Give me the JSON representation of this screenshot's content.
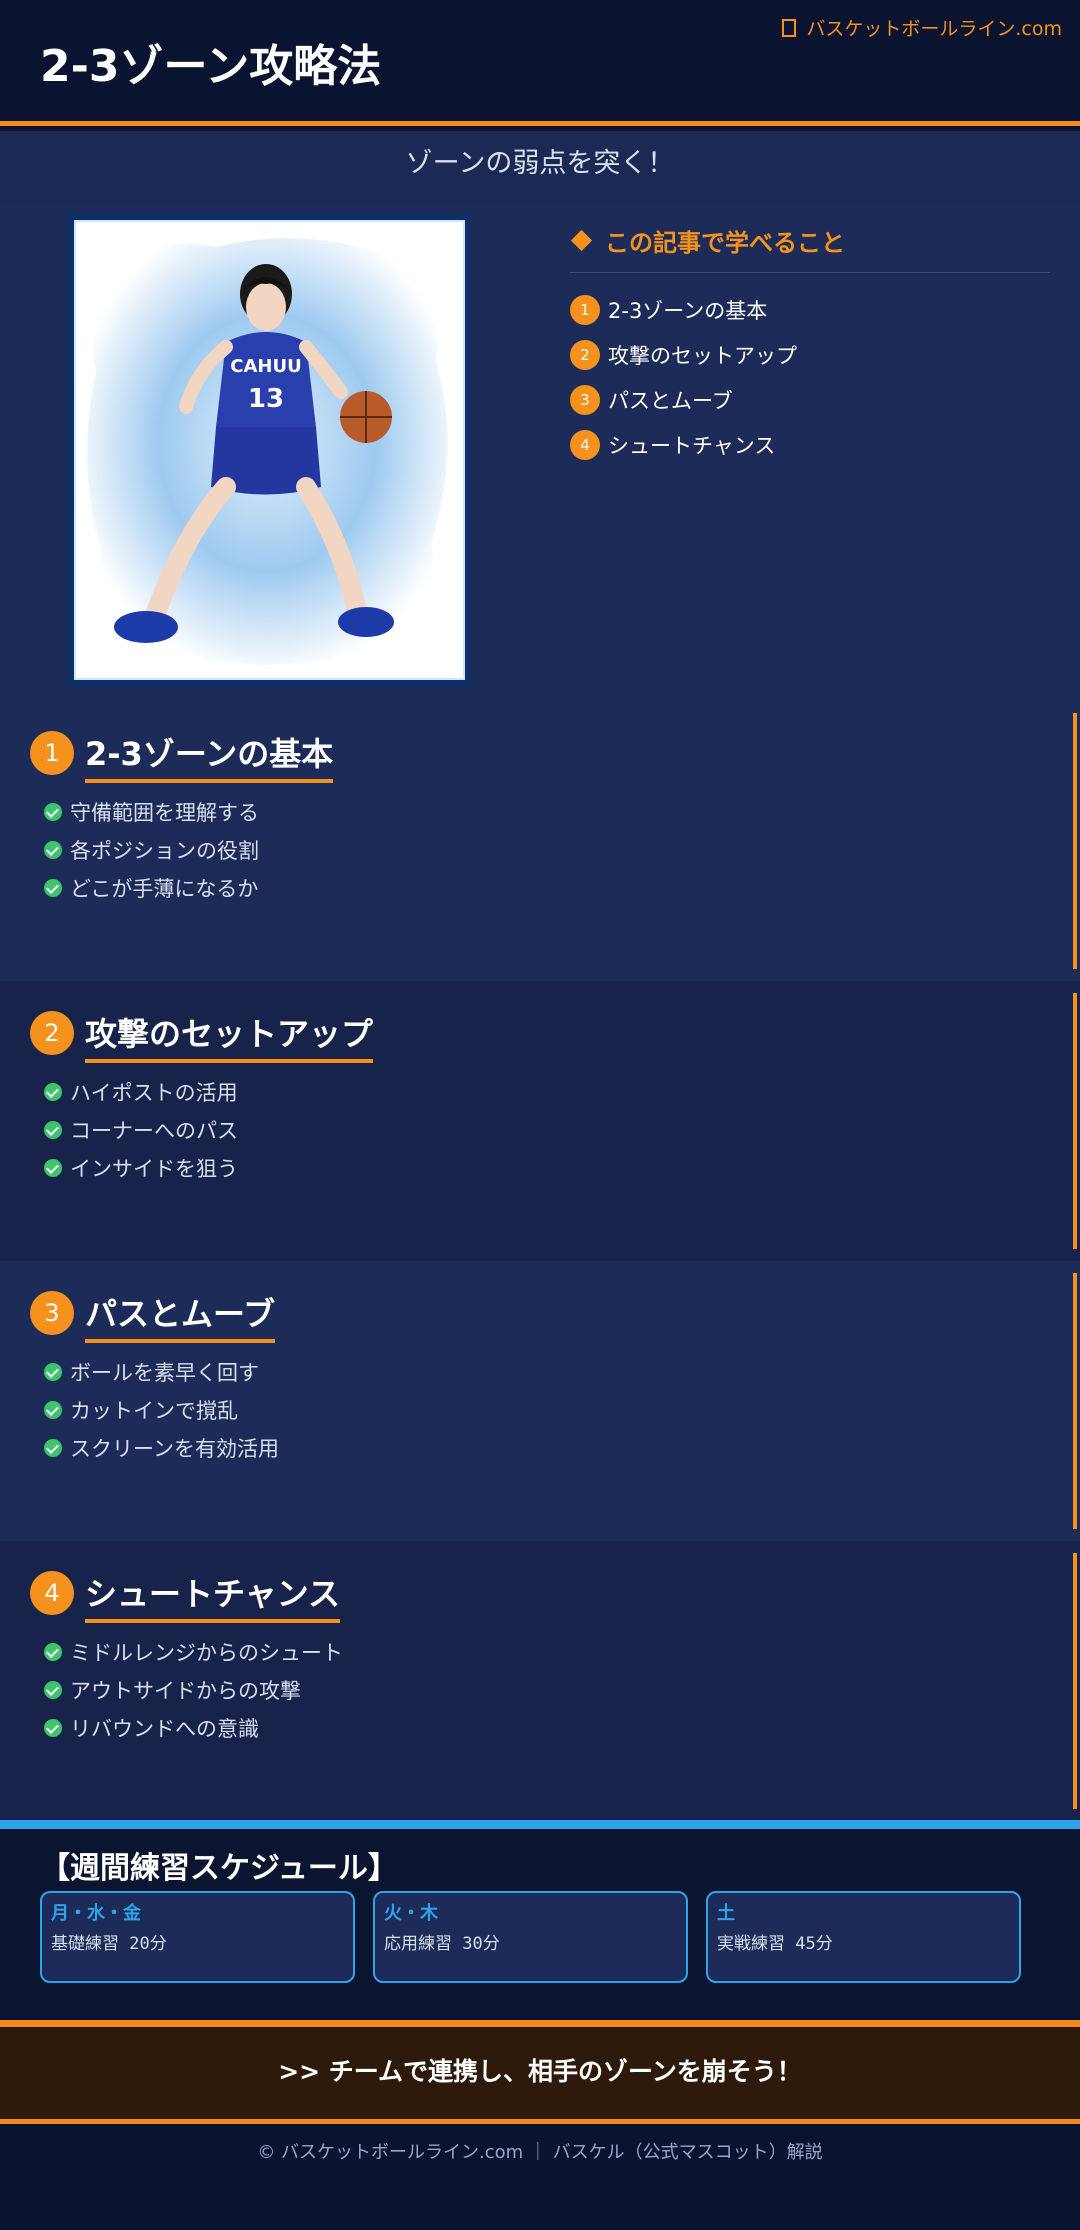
{
  "header": {
    "title": "2-3ゾーン攻略法",
    "site": "バスケットボールライン.com"
  },
  "subtitle": "ゾーンの弱点を突く！",
  "learn": {
    "heading": "この記事で学べること",
    "items": [
      {
        "num": "1",
        "label": "2-3ゾーンの基本"
      },
      {
        "num": "2",
        "label": "攻撃のセットアップ"
      },
      {
        "num": "3",
        "label": "パスとムーブ"
      },
      {
        "num": "4",
        "label": "シュートチャンス"
      }
    ]
  },
  "photo": {
    "jersey_text": "CAHUU",
    "jersey_number": "13"
  },
  "sections": [
    {
      "num": "1",
      "title": "2-3ゾーンの基本",
      "points": [
        "守備範囲を理解する",
        "各ポジションの役割",
        "どこが手薄になるか"
      ]
    },
    {
      "num": "2",
      "title": "攻撃のセットアップ",
      "points": [
        "ハイポストの活用",
        "コーナーへのパス",
        "インサイドを狙う"
      ]
    },
    {
      "num": "3",
      "title": "パスとムーブ",
      "points": [
        "ボールを素早く回す",
        "カットインで撹乱",
        "スクリーンを有効活用"
      ]
    },
    {
      "num": "4",
      "title": "シュートチャンス",
      "points": [
        "ミドルレンジからのシュート",
        "アウトサイドからの攻撃",
        "リバウンドへの意識"
      ]
    }
  ],
  "schedule": {
    "title": "【週間練習スケジュール】",
    "cards": [
      {
        "day": "月・水・金",
        "detail": "基礎練習 20分"
      },
      {
        "day": "火・木",
        "detail": "応用練習 30分"
      },
      {
        "day": "土",
        "detail": "実戦練習 45分"
      }
    ]
  },
  "cta": ">> チームで連携し、相手のゾーンを崩そう！",
  "footer": "© バスケットボールライン.com ｜ バスケル（公式マスコット）解説",
  "colors": {
    "accent": "#f5921e",
    "blue_accent": "#2ea4ec",
    "check": "#3ec46d"
  }
}
